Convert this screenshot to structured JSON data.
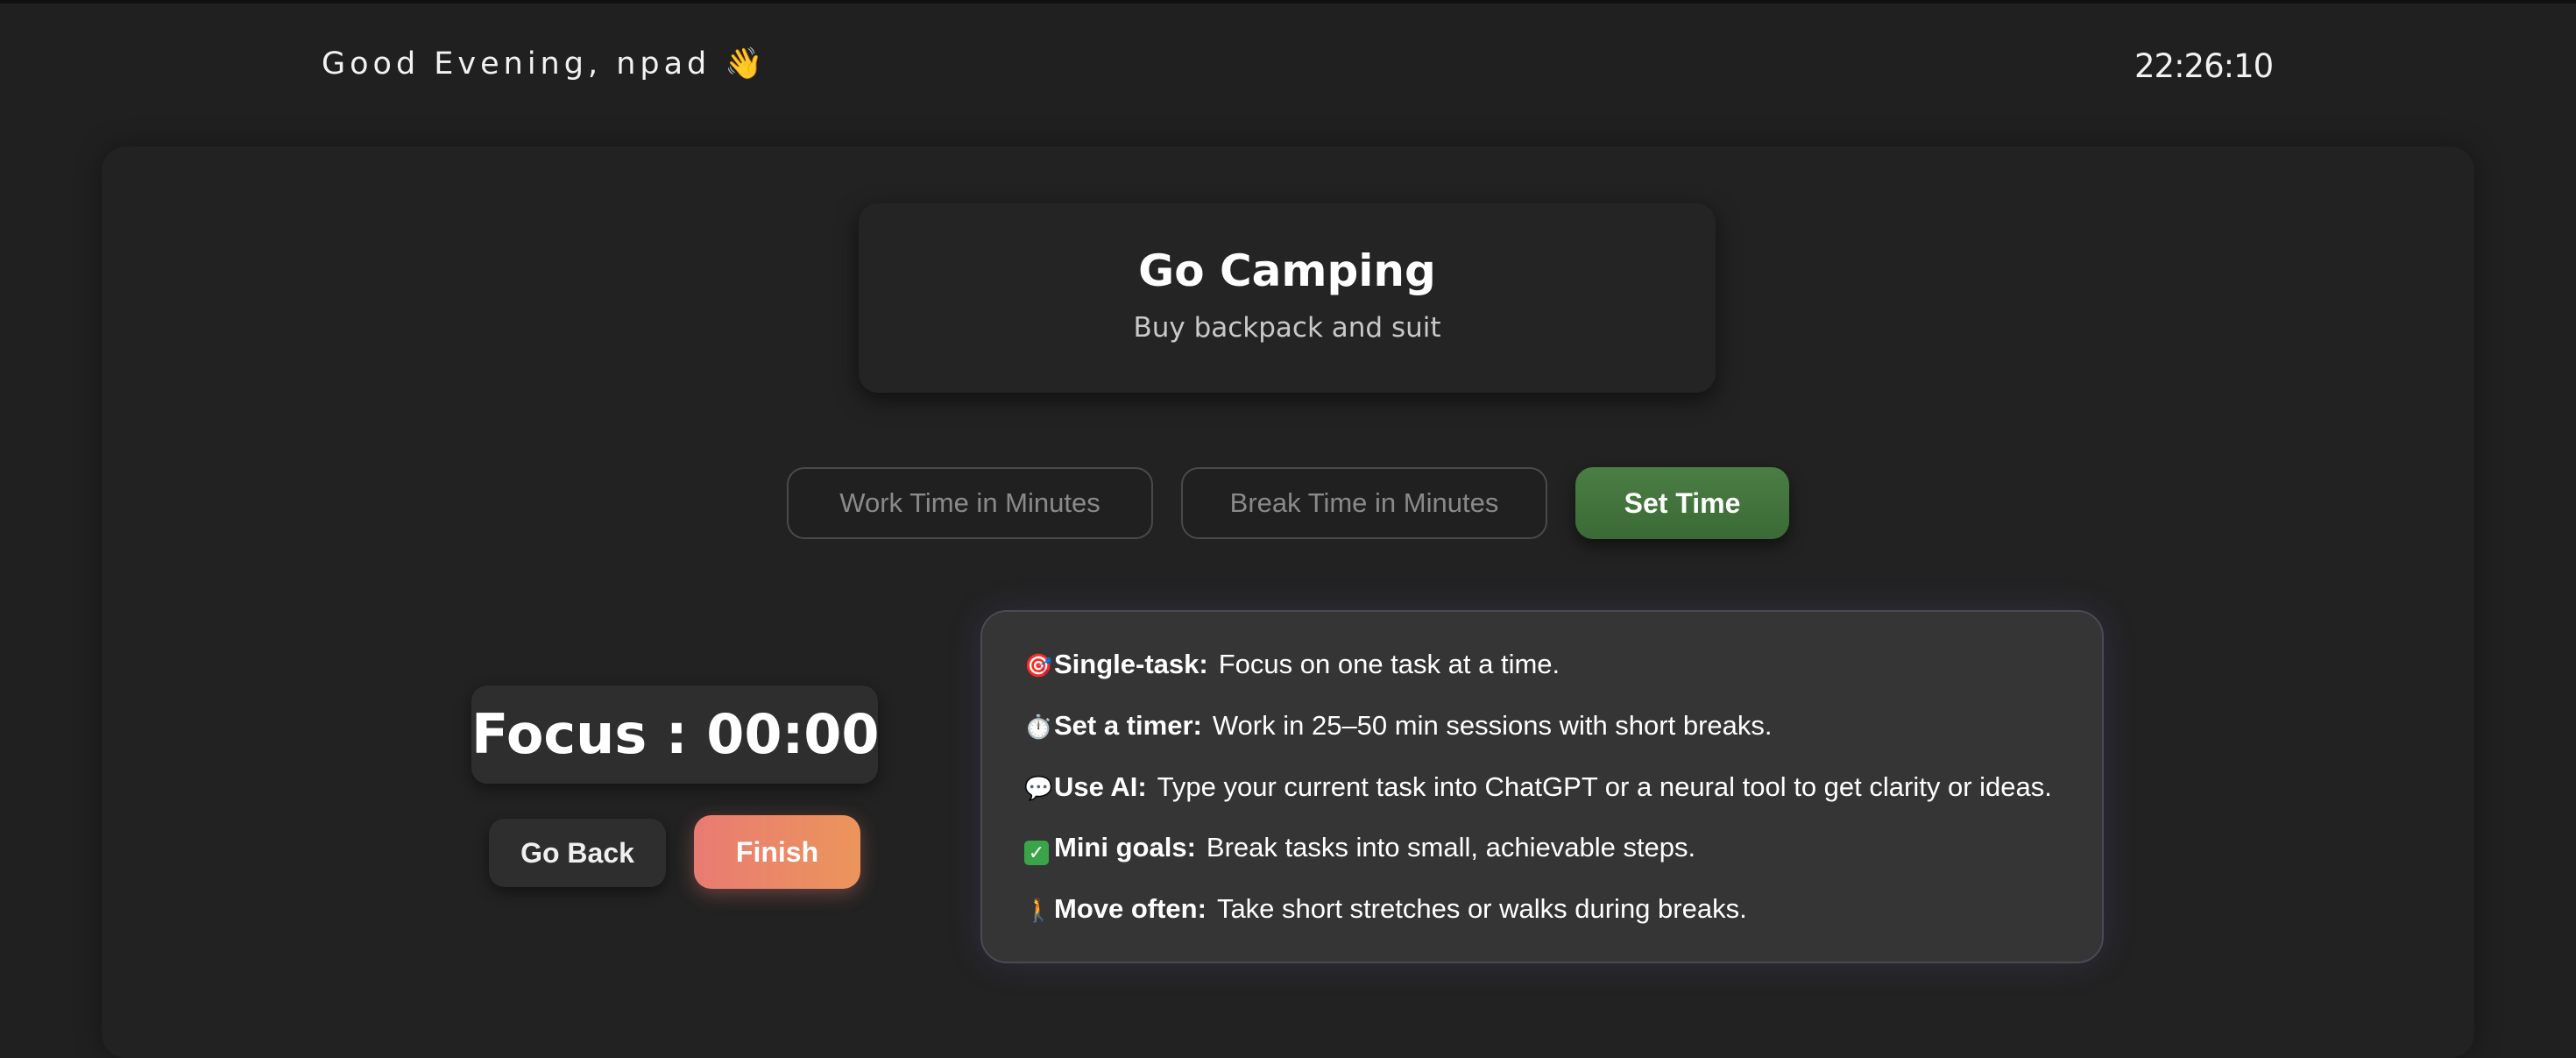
{
  "header": {
    "greeting": "Good Evening, npad 👋",
    "clock": "22:26:10"
  },
  "task": {
    "title": "Go Camping",
    "description": "Buy backpack and suit"
  },
  "timer_settings": {
    "work_placeholder": "Work Time in Minutes",
    "break_placeholder": "Break Time in Minutes",
    "set_label": "Set Time"
  },
  "timer": {
    "display": "Focus : 00:00",
    "go_back_label": "Go Back",
    "finish_label": "Finish"
  },
  "tips": [
    {
      "icon": "🎯",
      "icon_name": "target-icon",
      "label": "Single-task:",
      "text": "Focus on one task at a time."
    },
    {
      "icon": "⏱️",
      "icon_name": "stopwatch-icon",
      "label": "Set a timer:",
      "text": "Work in 25–50 min sessions with short breaks."
    },
    {
      "icon": "💬",
      "icon_name": "speech-bubble-icon",
      "label": "Use AI:",
      "text": "Type your current task into ChatGPT or a neural tool to get clarity or ideas."
    },
    {
      "icon": "✅",
      "icon_name": "check-mark-icon",
      "label": "Mini goals:",
      "text": "Break tasks into small, achievable steps."
    },
    {
      "icon": "🚶",
      "icon_name": "walking-person-icon",
      "label": "Move often:",
      "text": "Take short stretches or walks during breaks."
    }
  ],
  "colors": {
    "background": "#202020",
    "set_button": "#3f7139",
    "finish_gradient_start": "#e97b73",
    "finish_gradient_end": "#eb955b"
  }
}
